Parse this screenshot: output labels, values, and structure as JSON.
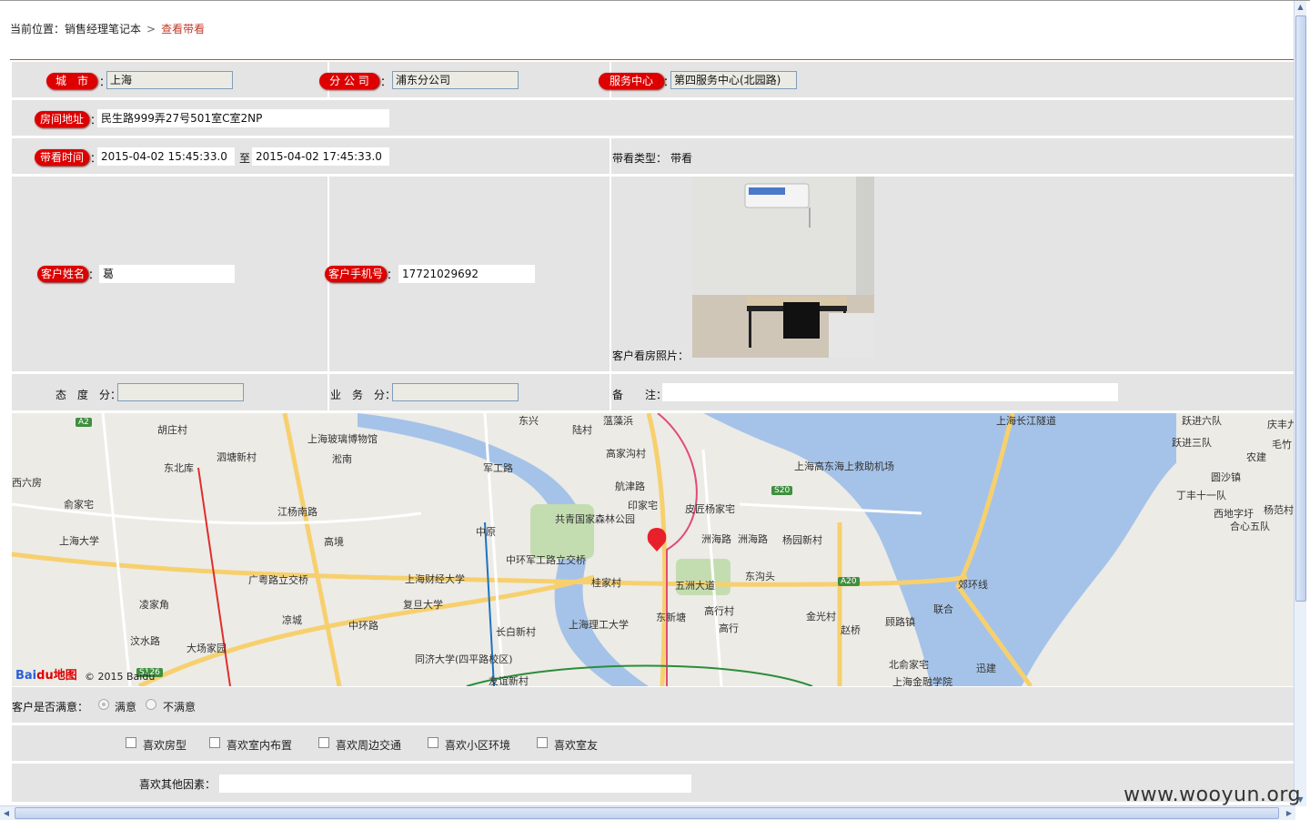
{
  "breadcrumb": {
    "prefix": "当前位置：",
    "parent": "销售经理笔记本",
    "separator": ">",
    "current": "查看带看"
  },
  "labels": {
    "city": "城　市",
    "branch": "分 公 司",
    "service_center": "服务中心",
    "address": "房间地址",
    "time": "带看时间",
    "to": "至",
    "visit_type": "带看类型：",
    "customer_name": "客户姓名",
    "customer_phone": "客户手机号",
    "photo": "客户看房照片：",
    "attitude": "态　度　分：",
    "business": "业　务　分：",
    "remark": "备　　注：",
    "satisfied_q": "客户是否满意：",
    "other_factors": "喜欢其他因素：",
    "colon": "："
  },
  "values": {
    "city": "上海",
    "branch": "浦东分公司",
    "service_center": "第四服务中心(北园路)",
    "address": "民生路999弄27号501室C室2NP",
    "time_start": "2015-04-02 15:45:33.0",
    "time_end": "2015-04-02 17:45:33.0",
    "visit_type": "带看",
    "customer_name": "葛",
    "customer_phone": "17721029692",
    "attitude": "",
    "business": "",
    "remark": "",
    "other_factors": ""
  },
  "satisfaction": {
    "options": [
      "满意",
      "不满意"
    ],
    "selected": "满意"
  },
  "likes": [
    "喜欢房型",
    "喜欢室内布置",
    "喜欢周边交通",
    "喜欢小区环境",
    "喜欢室友"
  ],
  "map": {
    "logo_a": "Bai",
    "logo_b": "du地图",
    "copyright": "© 2015 Baidu",
    "labels": [
      "胡庄村",
      "上海玻璃博物馆",
      "泗塘新村",
      "淞南",
      "东北库",
      "西六房",
      "俞家宅",
      "上海大学",
      "江杨南路",
      "高境",
      "上海财经大学",
      "广粤路立交桥",
      "复旦大学",
      "凌家角",
      "凉城",
      "汶水路",
      "大场家园",
      "中环路",
      "长白新村",
      "同济大学(四平路校区)",
      "友谊新村",
      "中原",
      "中环军工路立交桥",
      "共青国家森林公园",
      "军工路",
      "高家沟村",
      "航津路",
      "印家宅",
      "皮匠杨家宅",
      "洲海路",
      "洲海路",
      "杨园新村",
      "桂家村",
      "五洲大道",
      "东沟头",
      "上海理工大学",
      "东新塘",
      "高行村",
      "高行",
      "金光村",
      "赵桥",
      "顾路镇",
      "联合",
      "北俞家宅",
      "上海金融学院",
      "迅建",
      "上海高东海上救助机场",
      "郊环线",
      "上海长江隧道",
      "跃进六队",
      "跃进三队",
      "庆丰九",
      "毛竹",
      "农建",
      "圆沙镇",
      "丁丰十一队",
      "西地字圩",
      "合心五队",
      "杨范村",
      "陆村",
      "东兴",
      "蕰藻浜"
    ],
    "road_badges": [
      "S20",
      "A20",
      "A2",
      "S126"
    ]
  },
  "watermark": "www.wooyun.org",
  "colors": {
    "label_red": "#dd0000",
    "row_bg": "#e4e4e4",
    "accent": "#c0392b",
    "water": "#a5c3e8"
  }
}
